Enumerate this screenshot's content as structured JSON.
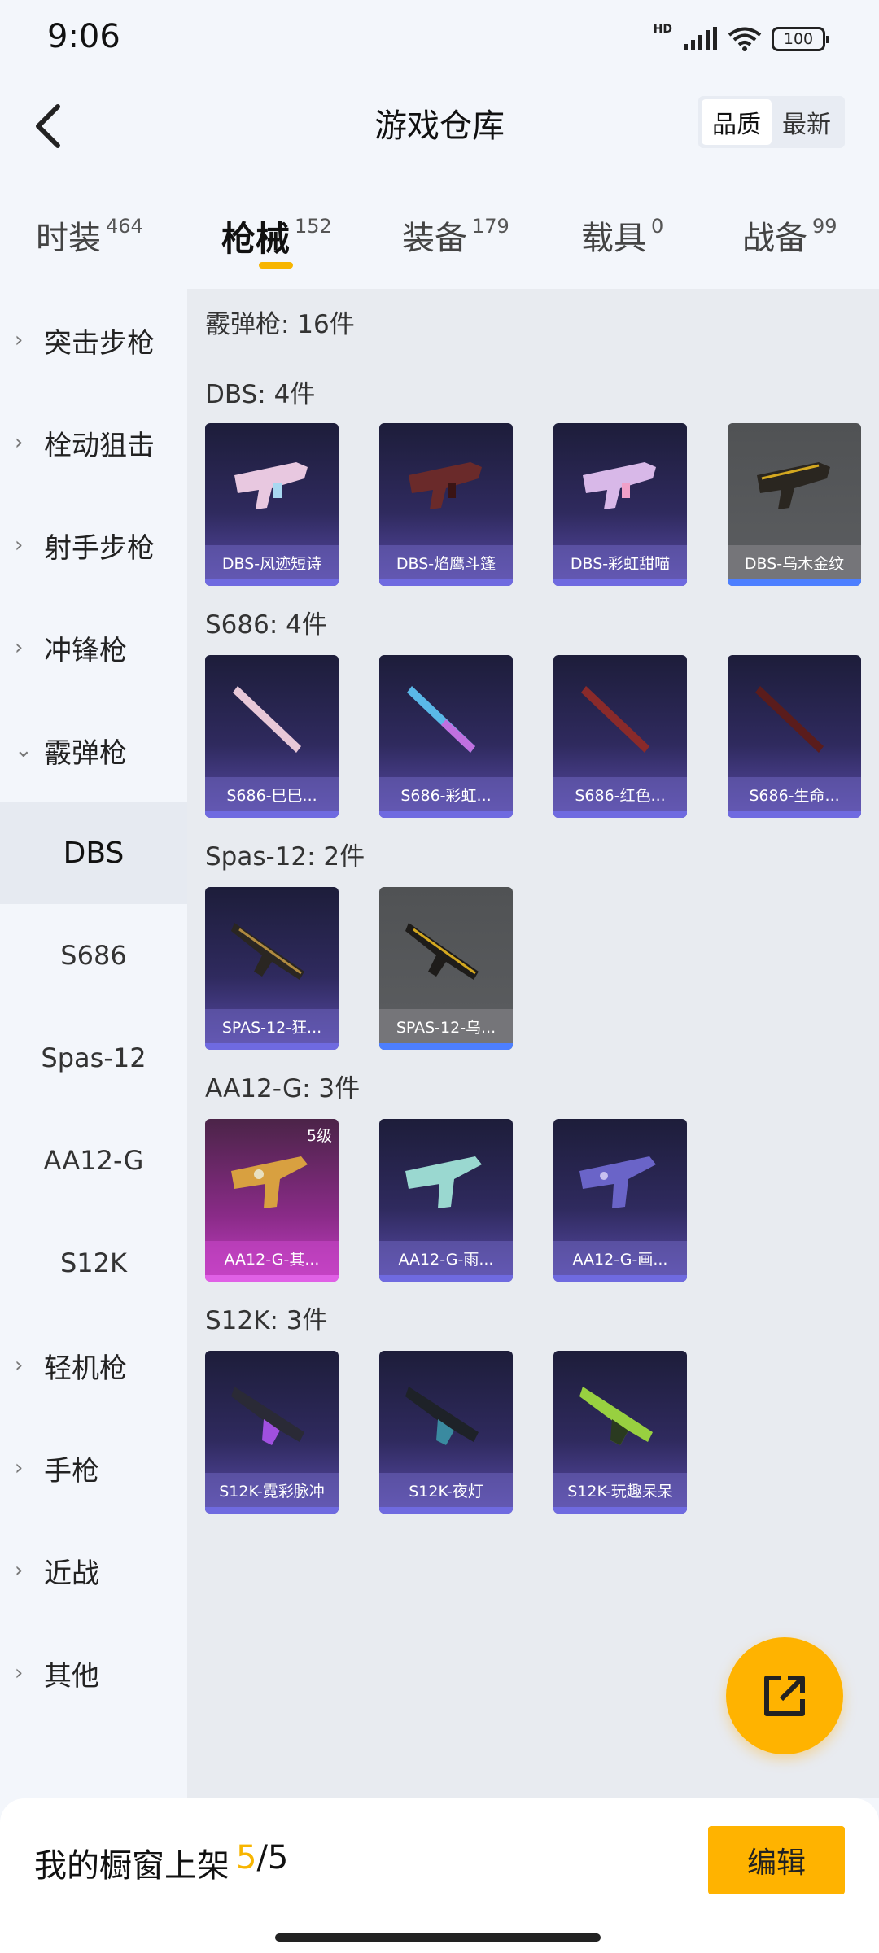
{
  "status": {
    "time": "9:06",
    "hd": "HD",
    "battery": "100"
  },
  "header": {
    "title": "游戏仓库",
    "toggle": [
      "品质",
      "最新"
    ]
  },
  "tabs": [
    {
      "label": "时装",
      "count": "464"
    },
    {
      "label": "枪械",
      "count": "152"
    },
    {
      "label": "装备",
      "count": "179"
    },
    {
      "label": "载具",
      "count": "0"
    },
    {
      "label": "战备",
      "count": "99"
    }
  ],
  "sidebar": {
    "categories": [
      "突击步枪",
      "栓动狙击",
      "射手步枪",
      "冲锋枪",
      "霰弹枪"
    ],
    "subitems": [
      "DBS",
      "S686",
      "Spas-12",
      "AA12-G",
      "S12K"
    ],
    "more_categories": [
      "轻机枪",
      "手枪",
      "近战",
      "其他"
    ]
  },
  "content": {
    "total": "霰弹枪: 16件",
    "groups": [
      {
        "title": "DBS: 4件",
        "items": [
          "DBS-风迹短诗",
          "DBS-焰鹰斗篷",
          "DBS-彩虹甜喵",
          "DBS-乌木金纹"
        ]
      },
      {
        "title": "S686: 4件",
        "items": [
          "S686-巳巳...",
          "S686-彩虹...",
          "S686-红色...",
          "S686-生命..."
        ]
      },
      {
        "title": "Spas-12: 2件",
        "items": [
          "SPAS-12-狂...",
          "SPAS-12-乌..."
        ]
      },
      {
        "title": "AA12-G: 3件",
        "items": [
          "AA12-G-其...",
          "AA12-G-雨...",
          "AA12-G-画..."
        ],
        "level": "5级"
      },
      {
        "title": "S12K: 3件",
        "items": [
          "S12K-霓彩脉冲",
          "S12K-夜灯",
          "S12K-玩趣呆呆"
        ]
      }
    ]
  },
  "bottom": {
    "text": "我的橱窗上架",
    "current": "5",
    "total": "/5",
    "edit": "编辑"
  },
  "colors": {
    "accent": "#ffb300",
    "card_purple": "#5a4cab",
    "card_grey": "#5c5e61",
    "card_pink": "#c43fc4"
  }
}
